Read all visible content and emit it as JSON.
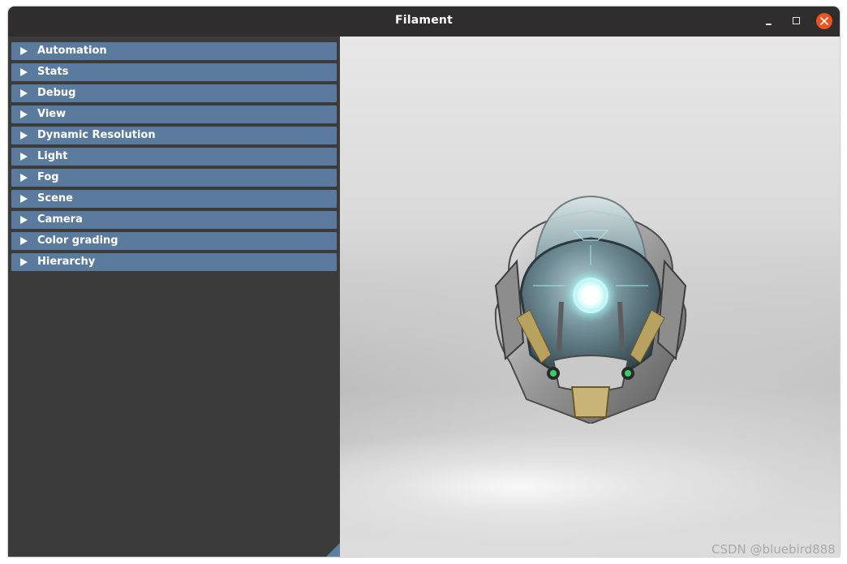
{
  "window": {
    "title": "Filament"
  },
  "panel": {
    "headers": [
      {
        "label": "Automation"
      },
      {
        "label": "Stats"
      },
      {
        "label": "Debug"
      },
      {
        "label": "View"
      },
      {
        "label": "Dynamic Resolution"
      },
      {
        "label": "Light"
      },
      {
        "label": "Fog"
      },
      {
        "label": "Scene"
      },
      {
        "label": "Camera"
      },
      {
        "label": "Color grading"
      },
      {
        "label": "Hierarchy"
      }
    ]
  },
  "viewport": {
    "model": "sci-fi helmet"
  },
  "watermark": "CSDN @bluebird888",
  "colors": {
    "titlebar": "#2f2d2d",
    "panel": "#3b3b3b",
    "header": "#5a7b9e",
    "close": "#e95420"
  }
}
